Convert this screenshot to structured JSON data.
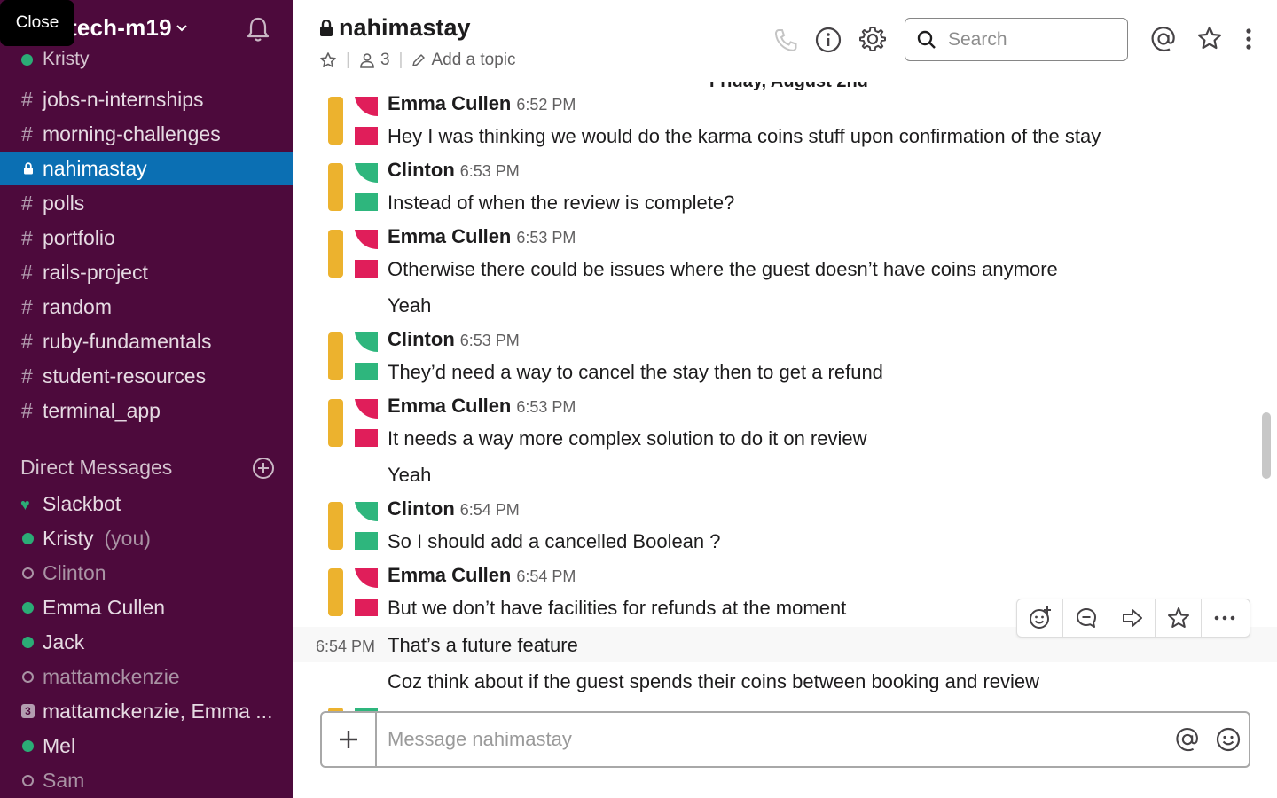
{
  "workspace": {
    "name": "tech-m19",
    "user": "Kristy",
    "tooltip": "Close"
  },
  "channels": [
    {
      "name": "jobs-n-internships",
      "private": false,
      "active": false
    },
    {
      "name": "morning-challenges",
      "private": false,
      "active": false
    },
    {
      "name": "nahimastay",
      "private": true,
      "active": true
    },
    {
      "name": "polls",
      "private": false,
      "active": false
    },
    {
      "name": "portfolio",
      "private": false,
      "active": false
    },
    {
      "name": "rails-project",
      "private": false,
      "active": false
    },
    {
      "name": "random",
      "private": false,
      "active": false
    },
    {
      "name": "ruby-fundamentals",
      "private": false,
      "active": false
    },
    {
      "name": "student-resources",
      "private": false,
      "active": false
    },
    {
      "name": "terminal_app",
      "private": false,
      "active": false
    }
  ],
  "dm": {
    "title": "Direct Messages",
    "items": [
      {
        "name": "Slackbot",
        "status": "bot"
      },
      {
        "name": "Kristy",
        "status": "online",
        "suffix": "(you)"
      },
      {
        "name": "Clinton",
        "status": "away"
      },
      {
        "name": "Emma Cullen",
        "status": "online"
      },
      {
        "name": "Jack",
        "status": "online"
      },
      {
        "name": "mattamckenzie",
        "status": "away"
      },
      {
        "name": "mattamckenzie, Emma ...",
        "status": "group",
        "count": "3"
      },
      {
        "name": "Mel",
        "status": "online"
      },
      {
        "name": "Sam",
        "status": "away"
      }
    ]
  },
  "header": {
    "channel": "nahimastay",
    "members": "3",
    "topic": "Add a topic",
    "search_placeholder": "Search"
  },
  "date_divider": "Friday, August 2nd",
  "messages": [
    {
      "author": "Emma Cullen",
      "time": "6:52 PM",
      "lines": [
        "Hey I was thinking we would do the karma coins stuff upon confirmation of the stay"
      ],
      "color": "#e01e5a"
    },
    {
      "author": "Clinton",
      "time": "6:53 PM",
      "lines": [
        "Instead of when the review is complete?"
      ],
      "color": "#2eb67d"
    },
    {
      "author": "Emma Cullen",
      "time": "6:53 PM",
      "lines": [
        "Otherwise there could be issues where the guest doesn’t have coins anymore",
        "Yeah"
      ],
      "color": "#e01e5a"
    },
    {
      "author": "Clinton",
      "time": "6:53 PM",
      "lines": [
        "They’d need a way to cancel the stay then to get a refund"
      ],
      "color": "#2eb67d"
    },
    {
      "author": "Emma Cullen",
      "time": "6:53 PM",
      "lines": [
        "It needs a way more complex solution to do it on review",
        "Yeah"
      ],
      "color": "#e01e5a"
    },
    {
      "author": "Clinton",
      "time": "6:54 PM",
      "lines": [
        "So I should add a cancelled Boolean ?"
      ],
      "color": "#2eb67d"
    },
    {
      "author": "Emma Cullen",
      "time": "6:54 PM",
      "lines": [
        "But we don’t have facilities for refunds at the moment"
      ],
      "color": "#e01e5a"
    }
  ],
  "hover_message": {
    "time": "6:54 PM",
    "text": "That’s a future feature"
  },
  "follow_message": "Coz think about if the guest spends their coins between booking and review",
  "composer": {
    "placeholder": "Message nahimastay"
  },
  "colors": {
    "sidebar": "#4d0a3c",
    "active": "#0b6fb3",
    "online": "#2bac76",
    "emma": "#e01e5a",
    "clinton": "#2eb67d",
    "avatar_bar": "#ecb22e"
  }
}
